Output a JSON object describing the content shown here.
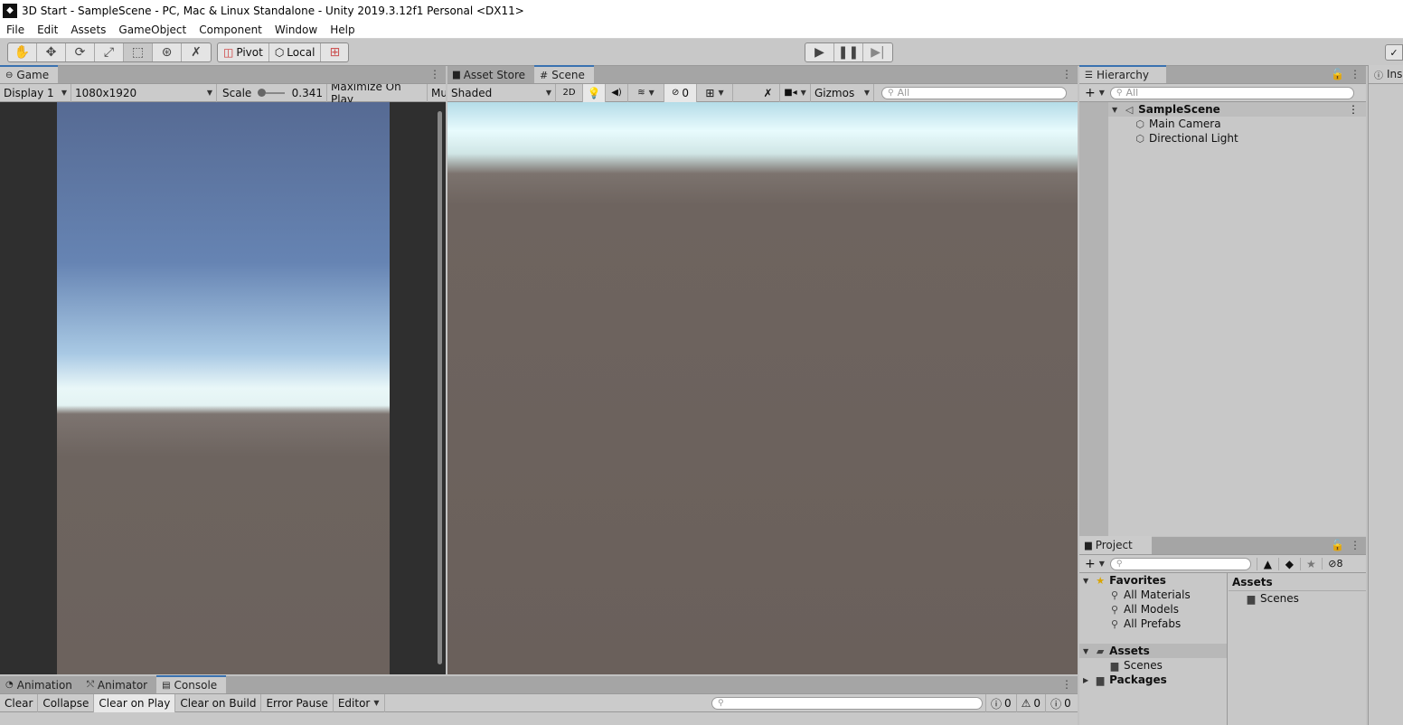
{
  "window": {
    "title": "3D Start - SampleScene - PC, Mac & Linux Standalone - Unity 2019.3.12f1 Personal <DX11>"
  },
  "menu": [
    "File",
    "Edit",
    "Assets",
    "GameObject",
    "Component",
    "Window",
    "Help"
  ],
  "toolbar": {
    "pivot_label": "Pivot",
    "local_label": "Local"
  },
  "game": {
    "tab_label": "Game",
    "display_label": "Display 1",
    "resolution_label": "1080x1920",
    "scale_label": "Scale",
    "scale_value": "0.341",
    "maximize_label": "Maximize On Play",
    "mute_label": "Mu"
  },
  "scene": {
    "tabs": [
      "Asset Store",
      "Scene"
    ],
    "shading_label": "Shaded",
    "mode_2d_label": "2D",
    "hidden_count": "0",
    "gizmos_label": "Gizmos",
    "search_placeholder": "All"
  },
  "hierarchy": {
    "tab_label": "Hierarchy",
    "search_placeholder": "All",
    "scene_name": "SampleScene",
    "items": [
      "Main Camera",
      "Directional Light"
    ]
  },
  "inspector": {
    "tab_label": "Ins"
  },
  "project": {
    "tab_label": "Project",
    "hidden_count": "8",
    "favorites_label": "Favorites",
    "favorites": [
      "All Materials",
      "All Models",
      "All Prefabs"
    ],
    "assets_label": "Assets",
    "assets_children": [
      "Scenes"
    ],
    "packages_label": "Packages",
    "right_header": "Assets",
    "right_items": [
      "Scenes"
    ]
  },
  "console": {
    "tabs": [
      "Animation",
      "Animator",
      "Console"
    ],
    "buttons": [
      "Clear",
      "Collapse",
      "Clear on Play",
      "Clear on Build",
      "Error Pause"
    ],
    "editor_label": "Editor",
    "counts": {
      "log": "0",
      "warning": "0",
      "error": "0"
    }
  },
  "colors": {
    "accent": "#3a72b0",
    "panel": "#cbcbcb",
    "tabbar": "#a5a5a5",
    "ground": "#6b625e"
  }
}
